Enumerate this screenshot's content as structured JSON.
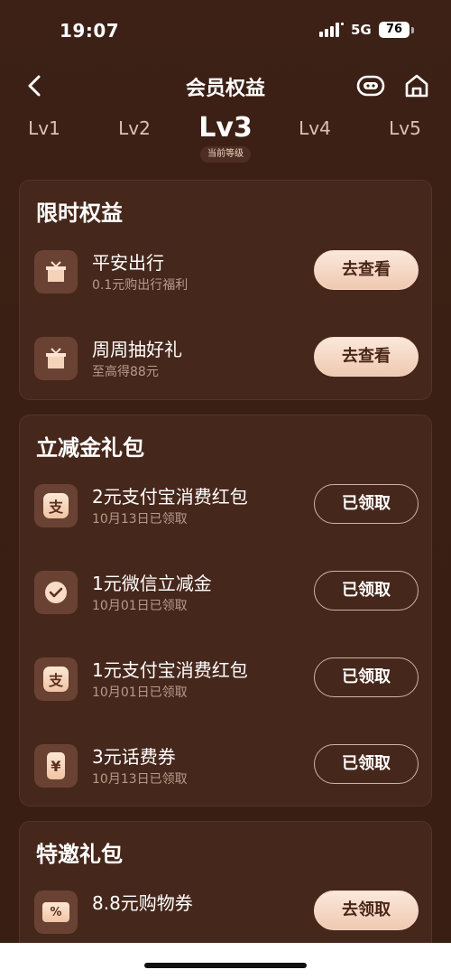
{
  "status": {
    "time": "19:07",
    "network": "5G",
    "battery": "76"
  },
  "nav": {
    "title": "会员权益"
  },
  "levels": {
    "items": [
      "Lv1",
      "Lv2",
      "Lv3",
      "Lv4",
      "Lv5"
    ],
    "current_badge": "当前等级"
  },
  "limited": {
    "title": "限时权益",
    "items": [
      {
        "name": "平安出行",
        "sub": "0.1元购出行福利",
        "button": "去查看"
      },
      {
        "name": "周周抽好礼",
        "sub": "至高得88元",
        "button": "去查看"
      }
    ]
  },
  "gift": {
    "title": "立减金礼包",
    "items": [
      {
        "name": "2元支付宝消费红包",
        "sub": "10月13日已领取",
        "button": "已领取",
        "icon_char": "支"
      },
      {
        "name": "1元微信立减金",
        "sub": "10月01日已领取",
        "button": "已领取"
      },
      {
        "name": "1元支付宝消费红包",
        "sub": "10月01日已领取",
        "button": "已领取",
        "icon_char": "支"
      },
      {
        "name": "3元话费券",
        "sub": "10月13日已领取",
        "button": "已领取",
        "icon_char": "¥"
      }
    ]
  },
  "special": {
    "title": "特邀礼包",
    "items": [
      {
        "name": "8.8元购物券",
        "button": "去领取",
        "icon_char": "%"
      }
    ]
  }
}
